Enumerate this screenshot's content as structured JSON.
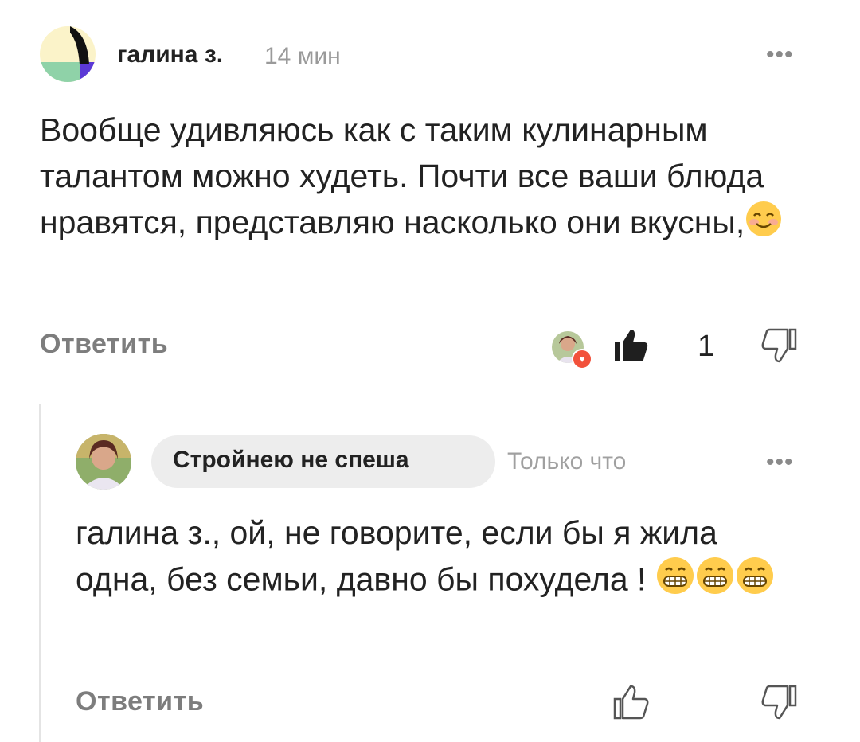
{
  "comment": {
    "author": "галина з.",
    "time": "14 мин",
    "more": "•••",
    "text": "Вообще удивляюсь как с таким кулинарным талантом можно худеть. Почти все ваши блюда нравятся, представляю насколько они вкусны,",
    "emoji_after_text": "smiling-face-icon",
    "reply_label": "Ответить",
    "likes_count": "1",
    "liked": true,
    "reaction_icon": "heart-icon"
  },
  "reply": {
    "author": "Стройнею не спеша",
    "time": "Только что",
    "more": "•••",
    "text": "галина з., ой, не говорите, если бы я жила одна, без семьи, давно бы похудела !",
    "emojis_after_text": [
      "grinning-face-icon",
      "grinning-face-icon",
      "grinning-face-icon"
    ],
    "reply_label": "Ответить"
  },
  "colors": {
    "accent_like": "#1f1f1f",
    "heart": "#f2513b",
    "muted_text": "#9a9a9a",
    "pill_bg": "#ededed"
  }
}
